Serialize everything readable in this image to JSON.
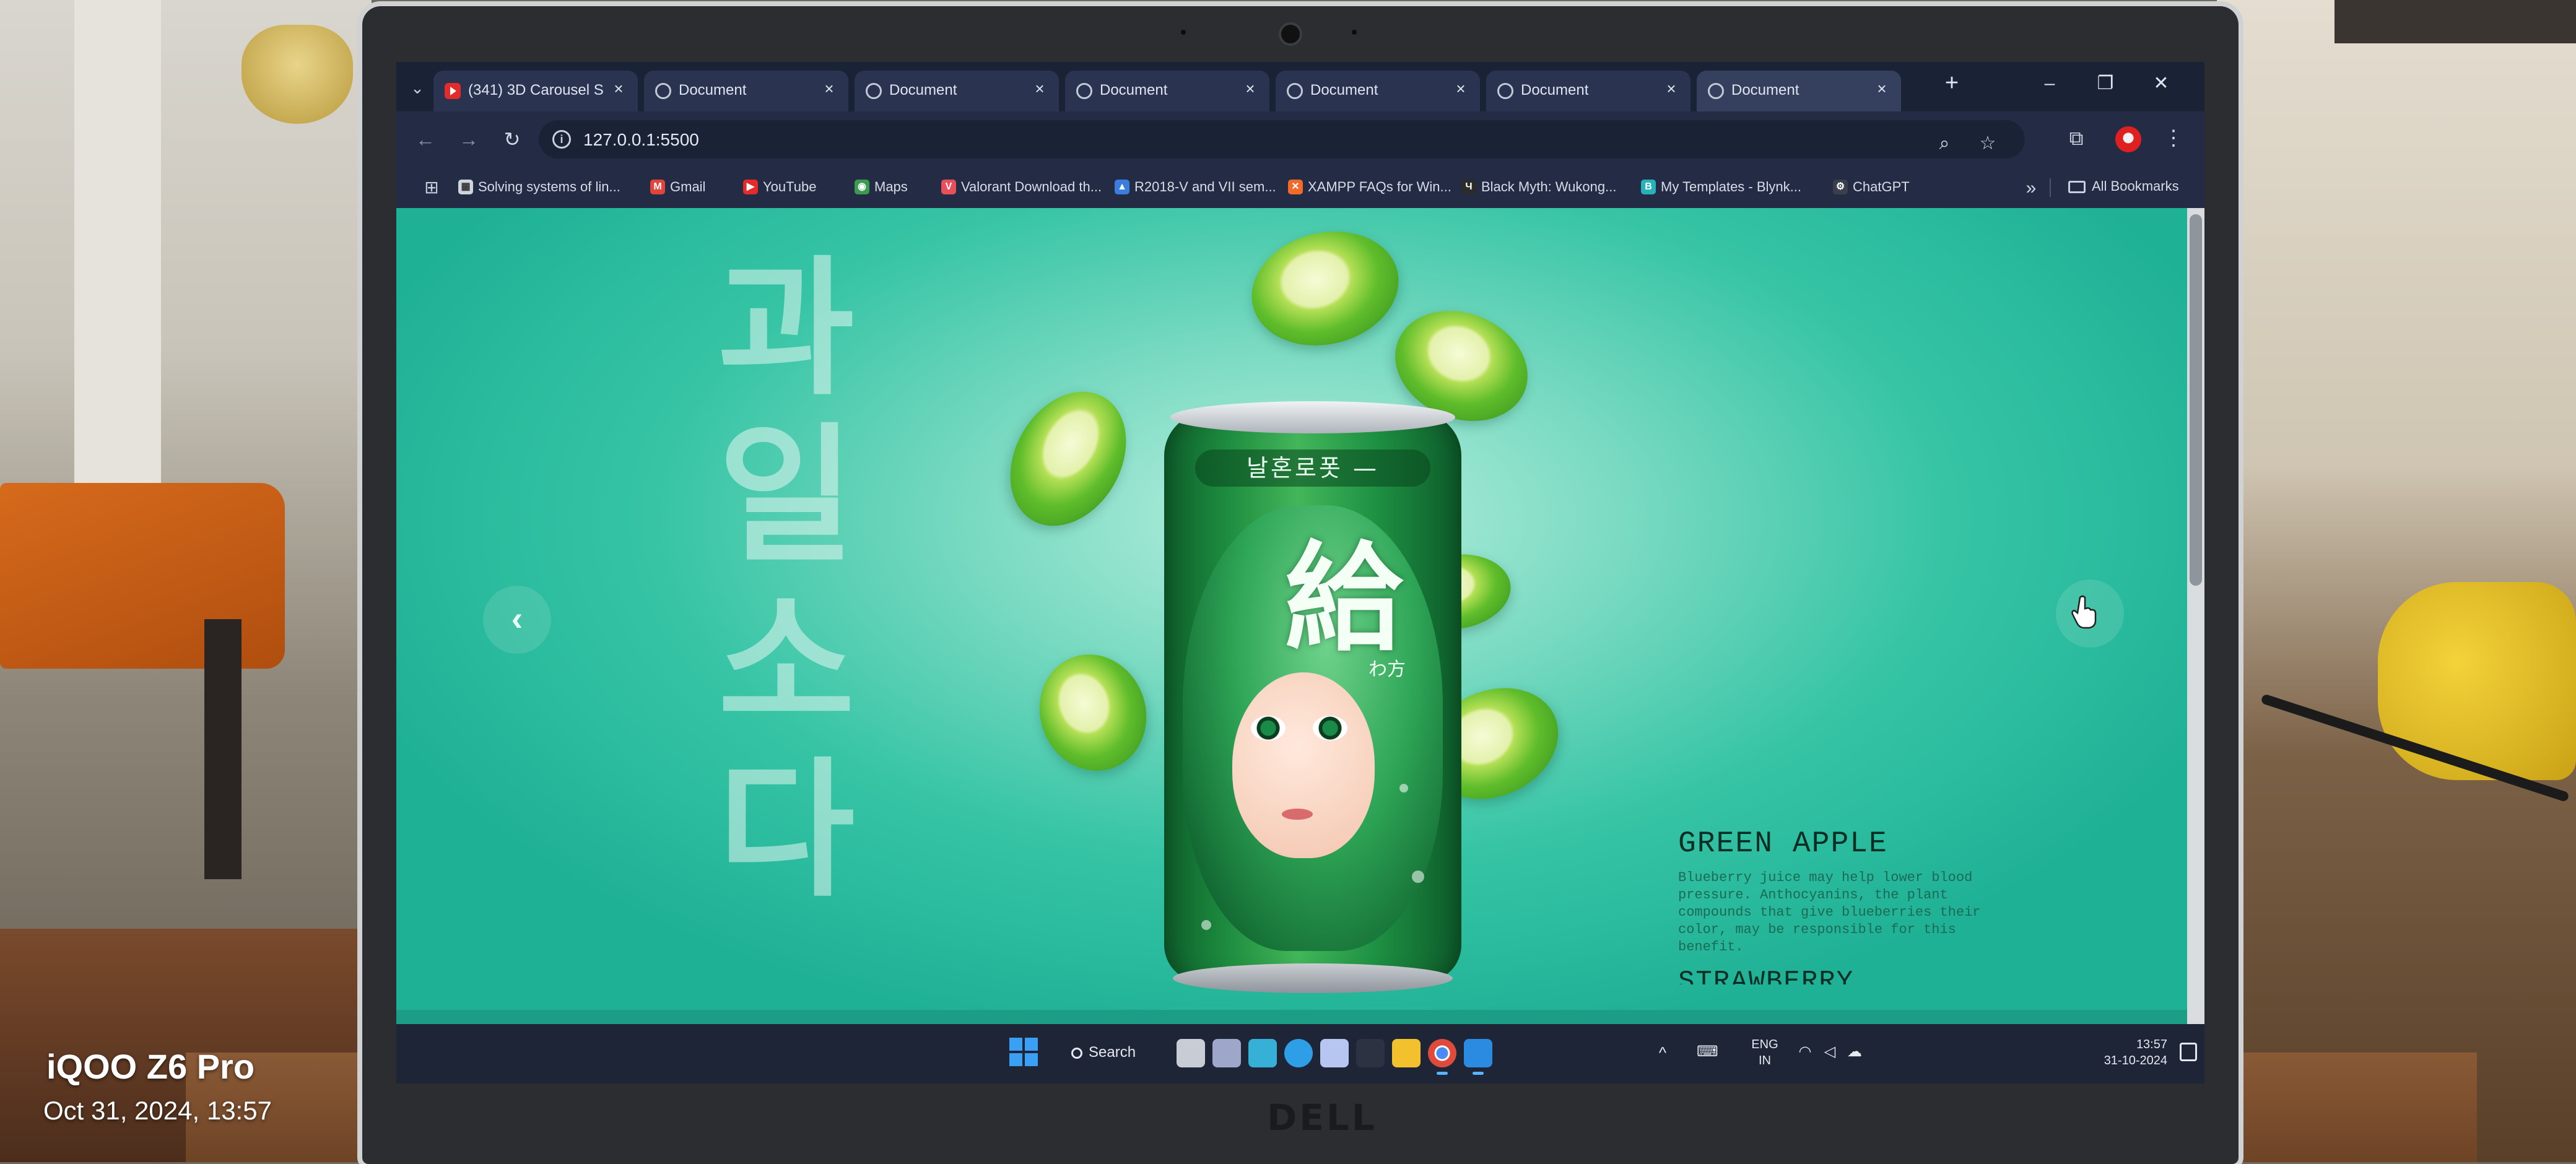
{
  "photo": {
    "camera_model": "iQOO Z6 Pro",
    "capture_datetime": "Oct 31, 2024, 13:57",
    "laptop_brand": "DELL"
  },
  "browser": {
    "tab_list_icon": "chevron-down-icon",
    "tabs": [
      {
        "title": "(341) 3D Carousel S",
        "icon": "youtube-icon",
        "active": false
      },
      {
        "title": "Document",
        "icon": "globe-icon",
        "active": false
      },
      {
        "title": "Document",
        "icon": "globe-icon",
        "active": false
      },
      {
        "title": "Document",
        "icon": "globe-icon",
        "active": false
      },
      {
        "title": "Document",
        "icon": "globe-icon",
        "active": false
      },
      {
        "title": "Document",
        "icon": "globe-icon",
        "active": false
      },
      {
        "title": "Document",
        "icon": "globe-icon",
        "active": true
      }
    ],
    "tab_close_glyph": "×",
    "new_tab_glyph": "+",
    "window_controls": {
      "minimize": "–",
      "restore": "❐",
      "close": "✕"
    },
    "toolbar": {
      "back_glyph": "←",
      "forward_glyph": "→",
      "reload_glyph": "↻",
      "url": "127.0.0.1:5500",
      "info_glyph": "i",
      "zoom_glyph": "⌕",
      "star_glyph": "☆",
      "extensions_glyph": "⧉",
      "menu_glyph": "⋮"
    },
    "bookmarks": [
      {
        "label": "Solving systems of lin...",
        "icon": "qr-icon",
        "color": "#cfd4de",
        "glyph": "▦"
      },
      {
        "label": "Gmail",
        "icon": "gmail-icon",
        "color": "#e1443a",
        "glyph": "M"
      },
      {
        "label": "YouTube",
        "icon": "youtube-icon",
        "color": "#e32b2b",
        "glyph": "▶"
      },
      {
        "label": "Maps",
        "icon": "maps-icon",
        "color": "#3a9b4f",
        "glyph": "◉"
      },
      {
        "label": "Valorant Download th...",
        "icon": "valorant-icon",
        "color": "#e8505b",
        "glyph": "V"
      },
      {
        "label": "R2018-V and VII sem...",
        "icon": "drive-icon",
        "color": "#3b7ddd",
        "glyph": "▲"
      },
      {
        "label": "XAMPP FAQs for Win...",
        "icon": "xampp-icon",
        "color": "#f06a2a",
        "glyph": "✕"
      },
      {
        "label": "Black Myth: Wukong...",
        "icon": "wukong-icon",
        "color": "#2b2b2b",
        "glyph": "Ч"
      },
      {
        "label": "My Templates - Blynk...",
        "icon": "blynk-icon",
        "color": "#29b1b9",
        "glyph": "B"
      },
      {
        "label": "ChatGPT",
        "icon": "chatgpt-icon",
        "color": "#3a3f4b",
        "glyph": "⚙"
      }
    ],
    "bookmarks_overflow_glyph": "»",
    "all_bookmarks_label": "All Bookmarks",
    "apps_glyph": "⊞"
  },
  "page": {
    "hangul_title_chars": [
      "과",
      "일",
      "소",
      "다"
    ],
    "prev_glyph": "‹",
    "next_glyph": "›",
    "can_brand_text": "날혼로폿 —",
    "can_logo_glyph": "給",
    "can_sub_glyph": "わ方",
    "product_name": "GREEN APPLE",
    "product_description": "Blueberry juice may help lower blood pressure. Anthocyanins, the plant compounds that give blueberries their color, may be responsible for this benefit.",
    "next_product_name": "STRAWBERRY",
    "colors": {
      "background_center": "#b8efe0",
      "background_edge": "#1fb196",
      "can_green": "#1c8a3e",
      "title_text": "#0b2e24"
    }
  },
  "taskbar": {
    "search_label": "Search",
    "apps": [
      {
        "name": "task-view-icon",
        "color": "#c8ccd4"
      },
      {
        "name": "meet-icon",
        "color": "#9ea6c9"
      },
      {
        "name": "copilot-icon",
        "color": "#37b0d8"
      },
      {
        "name": "edge-icon",
        "color": "#2e9ee6"
      },
      {
        "name": "snipping-tool-icon",
        "color": "#b7c6f0"
      },
      {
        "name": "widgets-icon",
        "color": "#2c3242"
      },
      {
        "name": "file-explorer-icon",
        "color": "#f4c12e"
      },
      {
        "name": "chrome-icon",
        "color": "#de4b3a"
      },
      {
        "name": "vscode-icon",
        "color": "#2a8be0"
      }
    ],
    "tray_chevron_glyph": "^",
    "language_line1": "ENG",
    "language_line2": "IN",
    "time": "13:57",
    "date": "31-10-2024"
  }
}
